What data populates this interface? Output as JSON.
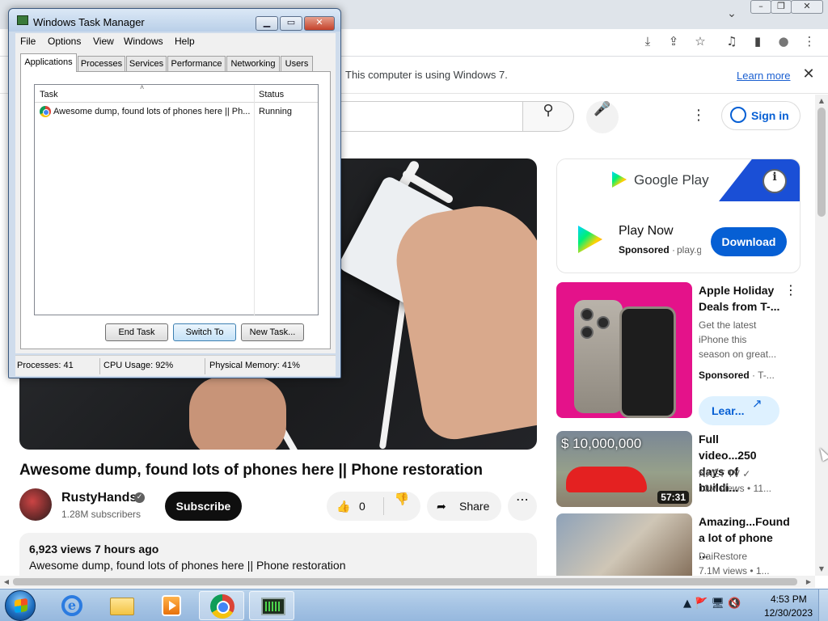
{
  "browser": {
    "tab_dropdown": "⌄",
    "window_controls": [
      "–",
      "❐",
      "✕"
    ],
    "toolbar_icons": [
      "install-icon",
      "share-icon",
      "star-icon",
      "media-icon",
      "sidebar-icon",
      "profile-icon",
      "menu-icon"
    ],
    "toolbar_glyphs": [
      "⤓",
      "⇪",
      "☆",
      "♫",
      "▮",
      "●",
      "⋮"
    ],
    "infobar": {
      "message": "This computer is using Windows 7.",
      "link": "Learn more",
      "close": "✕"
    }
  },
  "youtube": {
    "search_icon": "⚲",
    "mic_icon": "🎤",
    "more_icon": "⋮",
    "signin_label": "Sign in",
    "video_title": "Awesome dump, found lots of phones here || Phone restoration",
    "channel": {
      "name": "RustyHands",
      "verified": "✓",
      "subscribers": "1.28M subscribers",
      "subscribe_label": "Subscribe"
    },
    "actions": {
      "like_icon": "👍",
      "like_count": "0",
      "dislike_icon": "👎",
      "share_icon": "➦",
      "share_label": "Share",
      "more_icon": "⋯"
    },
    "description": {
      "stats": "6,923 views  7 hours ago",
      "text": "Awesome dump, found lots of phones here || Phone restoration"
    },
    "ad": {
      "brand": "Google Play",
      "info_icon": "i",
      "title": "Play Now",
      "sponsored": "Sponsored",
      "separator": "·",
      "domain": "play.g",
      "cta": "Download",
      "brand_color": "#1a4fd6"
    },
    "recommendations": [
      {
        "title": "Apple Holiday Deals from T-...",
        "meta_lines": [
          "Get the latest iPhone this season on great..."
        ],
        "sponsored": "Sponsored",
        "source": "· T-...",
        "cta": "Lear...",
        "cta_icon": "↗",
        "more_icon": "⋮"
      },
      {
        "title": "Full video...250 days of buildi...",
        "overlay": "$ 10,000,000",
        "channel": "NHẾT TV",
        "verified": "✓",
        "views": "10M views  • 11...",
        "duration": "57:31"
      },
      {
        "title": "Amazing...Found a lot of phone ...",
        "channel": "DaiRestore",
        "views": "7.1M views  • 1..."
      }
    ]
  },
  "task_manager": {
    "title": "Windows Task Manager",
    "controls": [
      "▁",
      "▭",
      "✕"
    ],
    "menu": [
      "File",
      "Options",
      "View",
      "Windows",
      "Help"
    ],
    "tabs": [
      "Applications",
      "Processes",
      "Services",
      "Performance",
      "Networking",
      "Users"
    ],
    "active_tab": "Applications",
    "columns": [
      "Task",
      "Status"
    ],
    "sort_indicator": "˄",
    "rows": [
      {
        "task": "Awesome dump, found lots of phones here || Ph...",
        "status": "Running"
      }
    ],
    "buttons": [
      "End Task",
      "Switch To",
      "New Task..."
    ],
    "status_bar": {
      "processes": "Processes: 41",
      "cpu": "CPU Usage: 92%",
      "memory": "Physical Memory: 41%"
    }
  },
  "taskbar": {
    "apps": [
      "internet-explorer-icon",
      "file-explorer-icon",
      "media-player-icon",
      "chrome-icon",
      "task-manager-icon"
    ],
    "tray_icons": "▲  🚩 🖥 🔇",
    "time": "4:53 PM",
    "date": "12/30/2023"
  },
  "scrollbars": {
    "up": "▲",
    "down": "▼",
    "left": "◀",
    "right": "▶"
  }
}
